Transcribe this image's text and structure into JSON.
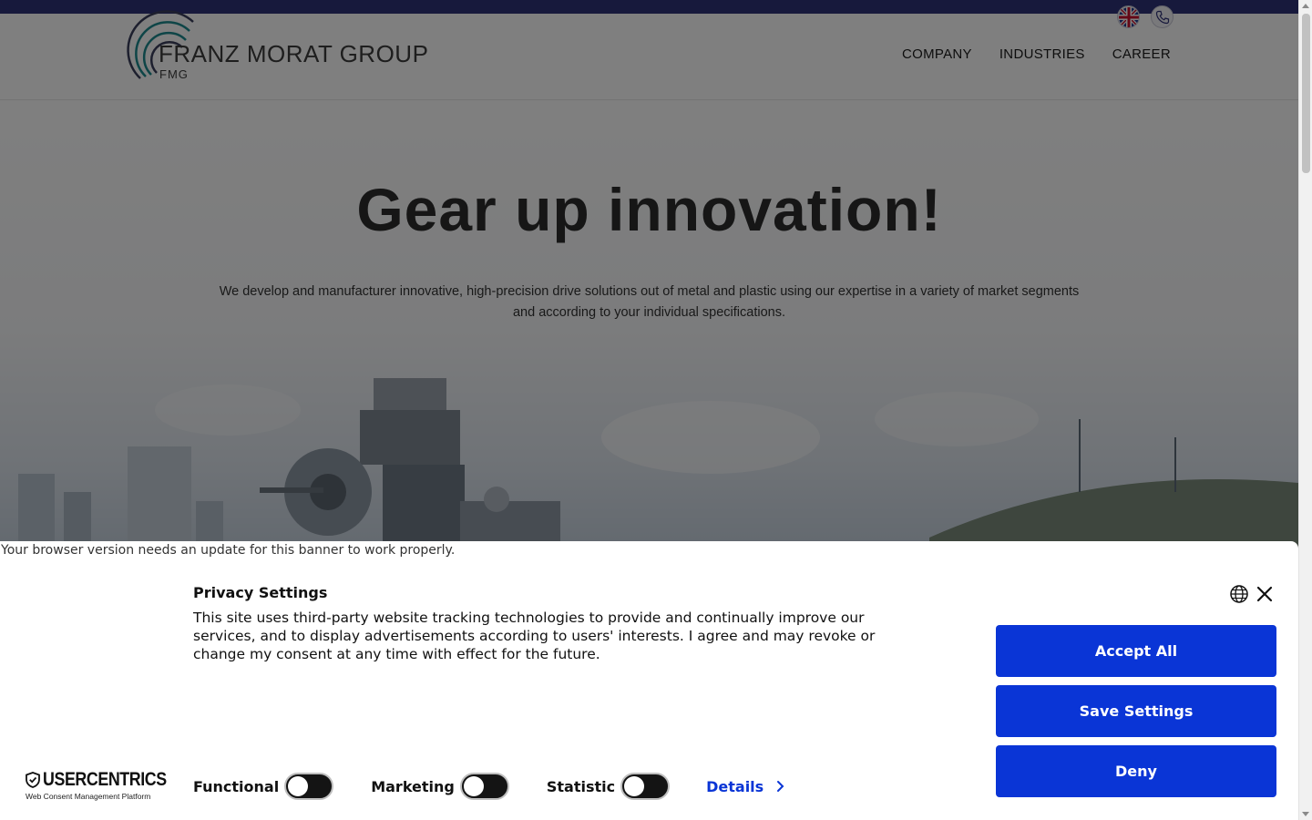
{
  "site": {
    "logo_name": "FRANZ MORAT GROUP",
    "logo_sub": "FMG",
    "icons": [
      "uk-flag-icon",
      "phone-icon"
    ],
    "nav": [
      {
        "label": "COMPANY"
      },
      {
        "label": "INDUSTRIES"
      },
      {
        "label": "CAREER"
      }
    ],
    "colors": {
      "top_strip": "#2f3278",
      "logo_arc_teal": "#1c8a8f",
      "logo_arc_dark": "#3a3f5c"
    }
  },
  "hero": {
    "title": "Gear up innovation!",
    "text": "We develop and manufacturer innovative, high-precision drive solutions out of metal and plastic using our expertise in a variety of market segments and according to your individual specifications."
  },
  "consent": {
    "warning": "Your browser version needs an update for this banner to work properly.",
    "title": "Privacy Settings",
    "text": "This site uses third-party website tracking technologies to provide and continually improve our services, and to display advertisements according to users' interests. I agree and may revoke or change my consent at any time with effect for the future.",
    "buttons": {
      "accept": "Accept All",
      "save": "Save Settings",
      "deny": "Deny"
    },
    "toggles": [
      {
        "label": "Functional",
        "on": false
      },
      {
        "label": "Marketing",
        "on": false
      },
      {
        "label": "Statistic",
        "on": false
      }
    ],
    "details": "Details",
    "brand_name": "USERCENTRICS",
    "brand_sub": "Web Consent Management Platform",
    "icons": [
      "globe-icon",
      "close-icon",
      "chevron-right-icon",
      "shield-icon"
    ],
    "colors": {
      "primary": "#0a35d6",
      "switch_off": "#141414"
    }
  }
}
